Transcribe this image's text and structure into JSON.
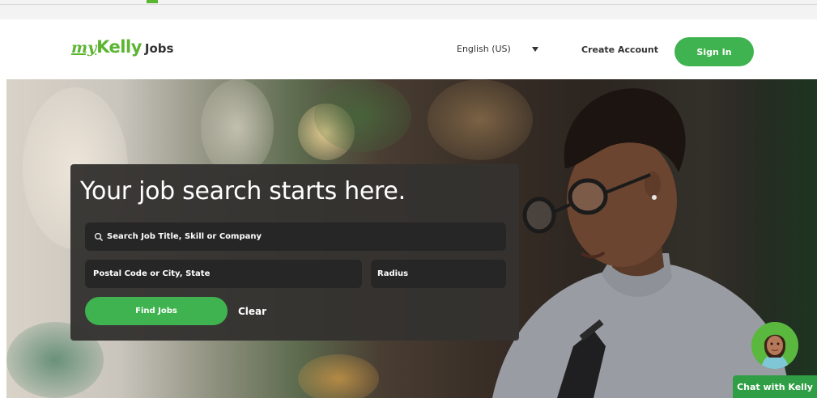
{
  "top_bar": {},
  "header": {
    "logo": {
      "my": "my",
      "kelly": "Kelly",
      "jobs": "Jobs"
    },
    "language": {
      "label": "English (US)",
      "icon": "caret-down-icon"
    },
    "create_account": "Create Account",
    "sign_in": "Sign In"
  },
  "hero": {
    "headline": "Your job search starts here.",
    "keyword_placeholder": "Search Job Title, Skill or Company",
    "keyword_icon": "search-icon",
    "location_placeholder": "Postal Code or City, State",
    "radius_label": "Radius",
    "find_jobs": "Find Jobs",
    "clear": "Clear"
  },
  "chat": {
    "label": "Chat with Kelly",
    "avatar_icon": "chat-avatar-icon"
  },
  "colors": {
    "brand_green": "#5cb531",
    "button_green": "#3fb34f",
    "card_bg": "#343230",
    "field_bg": "#262626",
    "chat_green": "#2f9e44"
  }
}
